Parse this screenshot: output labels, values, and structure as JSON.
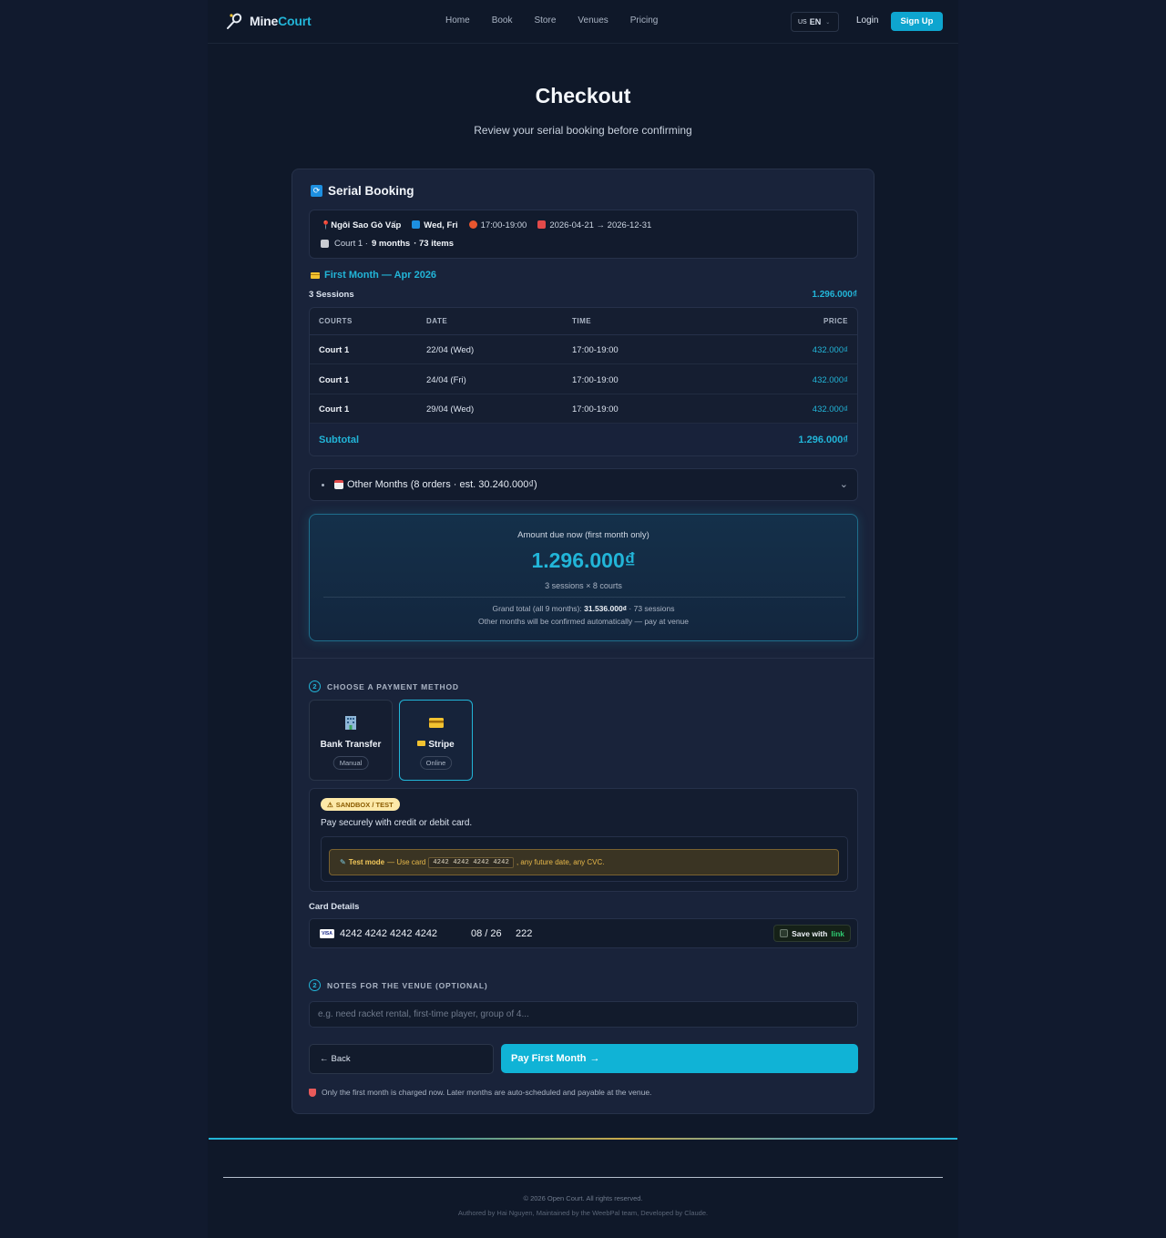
{
  "brand": {
    "part1": "Mine",
    "part2": "Court"
  },
  "nav": {
    "items": [
      "Home",
      "Book",
      "Store",
      "Venues",
      "Pricing"
    ]
  },
  "header": {
    "lang_flag": "US",
    "lang_code": "EN",
    "login": "Login",
    "signup": "Sign Up"
  },
  "page": {
    "title": "Checkout",
    "subtitle": "Review your serial booking before confirming"
  },
  "booking": {
    "heading": "Serial Booking",
    "venue": "Ngôi Sao Gò Vấp",
    "days": "Wed, Fri",
    "time": "17:00-19:00",
    "date_range": "2026-04-21 → 2026-12-31",
    "court": "Court 1 ·",
    "months": "9 months",
    "items": "· 73 items"
  },
  "first_month": {
    "heading": "First Month — Apr 2026",
    "sessions_label": "3 Sessions",
    "sessions_price": "1.296.000₫",
    "columns": [
      "COURTS",
      "DATE",
      "TIME",
      "PRICE"
    ],
    "rows": [
      {
        "court": "Court 1",
        "date": "22/04 (Wed)",
        "time": "17:00-19:00",
        "price": "432.000₫"
      },
      {
        "court": "Court 1",
        "date": "24/04 (Fri)",
        "time": "17:00-19:00",
        "price": "432.000₫"
      },
      {
        "court": "Court 1",
        "date": "29/04 (Wed)",
        "time": "17:00-19:00",
        "price": "432.000₫"
      }
    ],
    "subtotal_label": "Subtotal",
    "subtotal_value": "1.296.000₫"
  },
  "other_months": {
    "label": "Other Months (8 orders · est. 30.240.000₫)"
  },
  "amount": {
    "label": "Amount due now (first month only)",
    "value": "1.296.000₫",
    "breakdown": "3 sessions × 8 courts",
    "grand_prefix": "Grand total (all 9 months):",
    "grand_value": "31.536.000₫",
    "grand_suffix": "· 73 sessions",
    "note": "Other months will be confirmed automatically — pay at venue"
  },
  "payment": {
    "step": "2",
    "heading": "CHOOSE A PAYMENT METHOD",
    "methods": [
      {
        "name": "Bank Transfer",
        "tag": "Manual",
        "icon": "bank-icon"
      },
      {
        "name": "Stripe",
        "tag": "Online",
        "icon": "credit-card-icon"
      }
    ],
    "sandbox_badge": "SANDBOX / TEST",
    "description": "Pay securely with credit or debit card.",
    "test_mode_label": "Test mode",
    "test_mode_text1": "— Use card",
    "test_card": "4242 4242 4242 4242",
    "test_mode_text2": ", any future date, any CVC."
  },
  "card": {
    "label": "Card Details",
    "brand": "VISA",
    "number": "4242 4242 4242 4242",
    "expiry": "08 / 26",
    "cvc": "222",
    "save_label": "Save with",
    "save_link": "link"
  },
  "notes": {
    "step": "2",
    "heading": "NOTES FOR THE VENUE (OPTIONAL)",
    "placeholder": "e.g. need racket rental, first-time player, group of 4..."
  },
  "actions": {
    "back": "Back",
    "pay": "Pay First Month"
  },
  "footer_note": "Only the first month is charged now. Later months are auto-scheduled and payable at the venue.",
  "footer": {
    "copyright": "© 2026 Open Court. All rights reserved.",
    "authors": "Authored by Hai Nguyen, Maintained by the WeebPal team, Developed by Claude."
  },
  "colors": {
    "accent": "#22b5d8",
    "background": "#111a2e",
    "card": "#19233a",
    "sandbox": "#fde9a8"
  }
}
